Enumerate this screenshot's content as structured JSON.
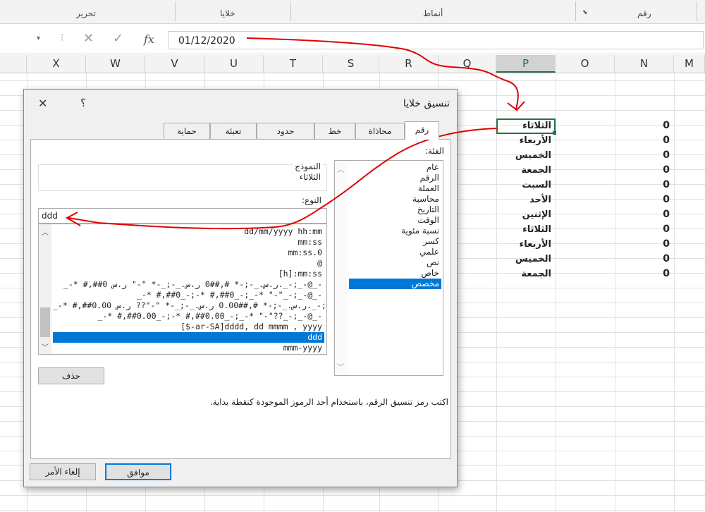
{
  "ribbon": {
    "groups": [
      "تحرير",
      "خلايا",
      "أنماط",
      "رقم"
    ]
  },
  "formula_bar": {
    "cancel_icon": "✕",
    "enter_icon": "✓",
    "fx_label": "fx",
    "value": "01/12/2020"
  },
  "columns": [
    "X",
    "W",
    "V",
    "U",
    "T",
    "S",
    "R",
    "Q",
    "P",
    "O",
    "N",
    "M"
  ],
  "selected_column": "P",
  "sheet": {
    "col_p_values": [
      "الثلاثاء",
      "الأربعاء",
      "الخميس",
      "الجمعة",
      "السبت",
      "الأحد",
      "الإثنين",
      "الثلاثاء",
      "الأربعاء",
      "الخميس",
      "الجمعة"
    ],
    "col_n_values": [
      "0",
      "0",
      "0",
      "0",
      "0",
      "0",
      "0",
      "0",
      "0",
      "0",
      "0"
    ]
  },
  "dialog": {
    "title": "تنسيق خلايا",
    "help": "؟",
    "close": "✕",
    "tabs": [
      "رقم",
      "محاذاة",
      "خط",
      "حدود",
      "تعبئة",
      "حماية"
    ],
    "active_tab": "رقم",
    "category_label": "الفئة:",
    "categories": [
      "عام",
      "الرقم",
      "العملة",
      "محاسبة",
      "التاريخ",
      "الوقت",
      "نسبة مئوية",
      "كسر",
      "علمي",
      "نص",
      "خاص",
      "مخصص"
    ],
    "selected_category": "مخصص",
    "sample_label": "النموذج",
    "sample_value": "الثلاثاء",
    "type_label": "النوع:",
    "type_value": "ddd",
    "type_list": [
      "dd/mm/yyyy hh:mm",
      "mm:ss",
      "mm:ss.0",
      "@",
      "[h]:mm:ss",
      "_-* #,##0 ر.س._-;-* #,##0 ر.س._-;_-* \"-\" ر.س._-;_-@_-",
      "_-* #,##0_-;-* #,##0_-;_-* \"-\"_-;_-@_-",
      "_-* #,##0.00 ر.س._-;-* #,##0.00 ر.س._-;_-* \"-\"?? ر.س._-;_-@_-",
      "_-* #,##0.00_-;-* #,##0.00_-;_-* \"-\"??_-;_-@_-",
      "[$-ar-SA]dddd, dd mmmm , yyyy",
      "ddd",
      "mmm-yyyy"
    ],
    "selected_type": "ddd",
    "delete_button": "حذف",
    "hint": "اكتب رمز تنسيق الرقم، باستخدام أحد الرموز الموجودة كنقطة بداية.",
    "ok_button": "موافق",
    "cancel_button": "إلغاء الأمر"
  },
  "colors": {
    "accent": "#0078d7",
    "excel_green": "#217346",
    "annotation": "#e00000"
  }
}
